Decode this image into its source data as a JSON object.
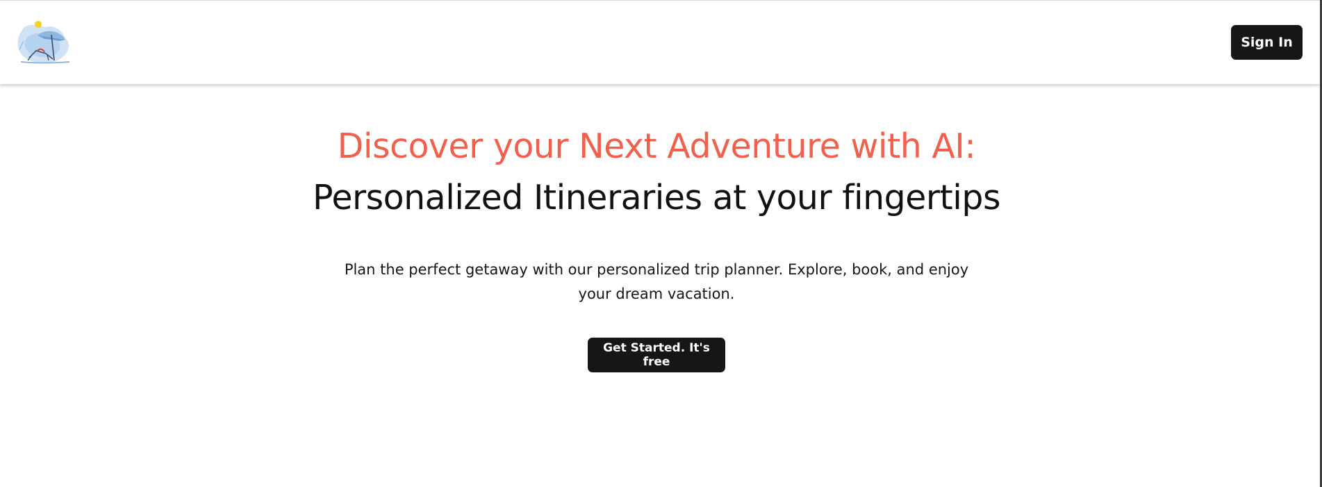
{
  "header": {
    "logo_icon": "beach-umbrella-chair-logo",
    "signin_label": "Sign In"
  },
  "hero": {
    "title_accent": "Discover your Next Adventure with AI:",
    "title_main": "Personalized Itineraries at your fingertips",
    "subtitle": "Plan the perfect getaway with our personalized trip planner. Explore, book, and enjoy your dream vacation.",
    "cta_label": "Get Started. It's free"
  },
  "colors": {
    "accent": "#f0604c",
    "button_bg": "#161616",
    "text": "#111111",
    "background": "#ffffff"
  }
}
